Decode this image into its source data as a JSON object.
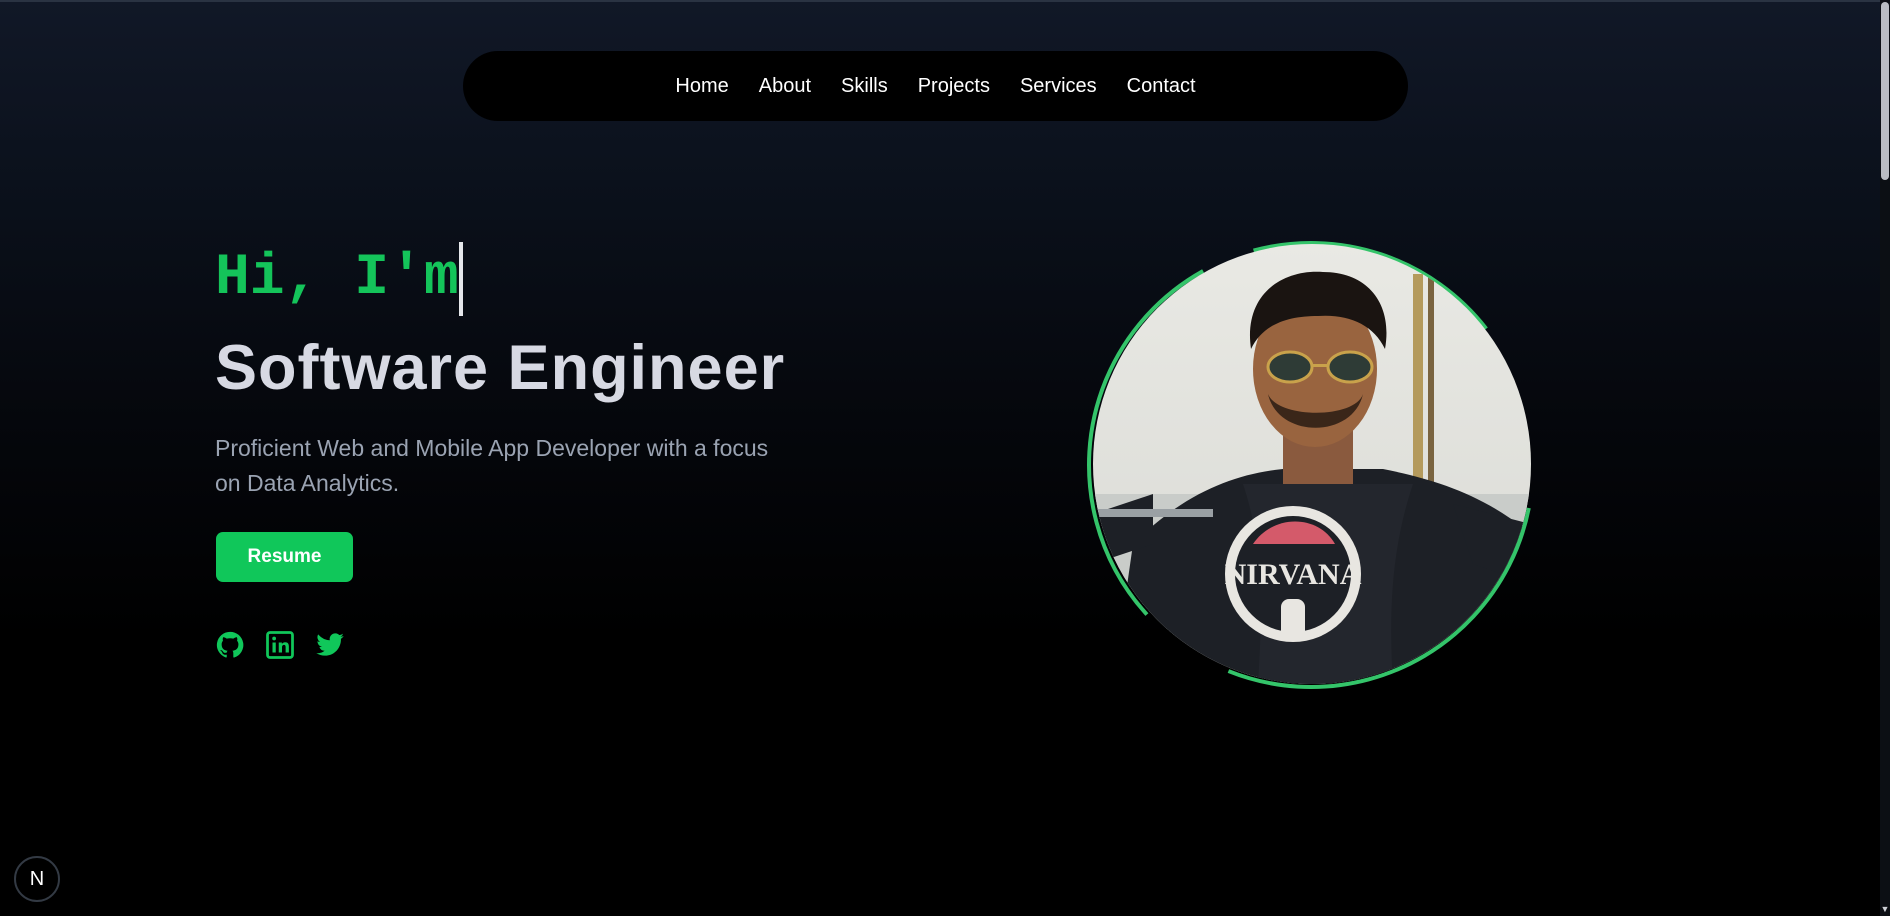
{
  "nav": {
    "items": [
      "Home",
      "About",
      "Skills",
      "Projects",
      "Services",
      "Contact"
    ]
  },
  "hero": {
    "greeting": "Hi, I'm",
    "role": "Software Engineer",
    "description": "Proficient Web and Mobile App Developer with a focus on Data Analytics.",
    "resume_label": "Resume"
  },
  "socials": [
    {
      "icon": "github-icon"
    },
    {
      "icon": "linkedin-icon"
    },
    {
      "icon": "twitter-icon"
    }
  ],
  "colors": {
    "accent": "#10c75a",
    "nav_bg": "#000000",
    "heading": "#d7d9e3",
    "muted": "#9aa3b2"
  },
  "portrait": {
    "shirt_text": "NIRVANA"
  },
  "dev_badge": {
    "label": "N"
  }
}
